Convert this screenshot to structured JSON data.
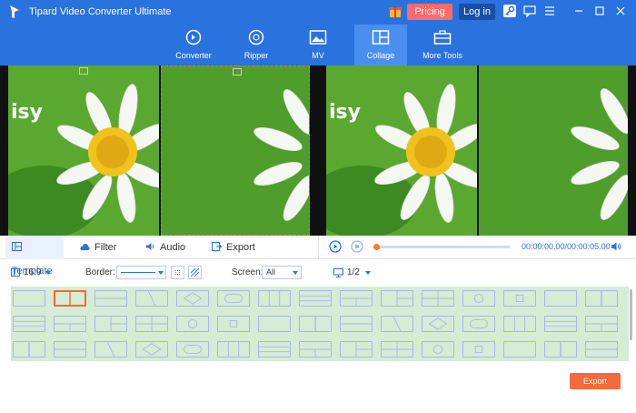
{
  "app": {
    "title": "Tipard Video Converter Ultimate",
    "pricing_label": "Pricing",
    "login_label": "Log in",
    "accent": "#2a72dd",
    "pricing_color": "#ff6a6a"
  },
  "nav": {
    "items": [
      {
        "label": "Converter",
        "icon": "converter-icon"
      },
      {
        "label": "Ripper",
        "icon": "disc-icon"
      },
      {
        "label": "MV",
        "icon": "image-icon"
      },
      {
        "label": "Collage",
        "icon": "collage-icon",
        "active": true
      },
      {
        "label": "More Tools",
        "icon": "toolbox-icon"
      }
    ]
  },
  "preview": {
    "overlay_text": "isy"
  },
  "tabs": {
    "template": "Template",
    "filter": "Filter",
    "audio": "Audio",
    "export": "Export"
  },
  "player": {
    "timecode": "00:00:00.00/00:00:05.00",
    "progress": 0.0
  },
  "options": {
    "aspect": "16:9",
    "border_label": "Border:",
    "screen_label": "Screen:",
    "screen_value": "All",
    "page": "1/2"
  },
  "footer": {
    "export_label": "Export",
    "export_color": "#f26b3a"
  }
}
